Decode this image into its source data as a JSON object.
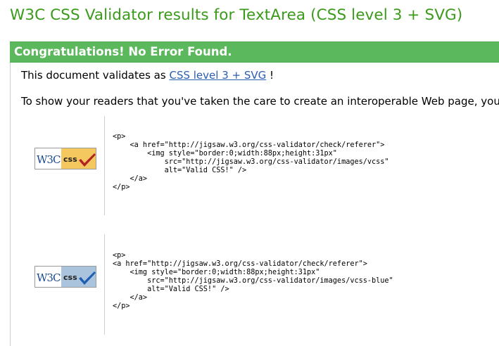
{
  "title": "W3C CSS Validator results for TextArea (CSS level 3 + SVG)",
  "banner": "Congratulations! No Error Found.",
  "validates": {
    "prefix": "This document validates as ",
    "link": "CSS level 3 + SVG",
    "suffix": " !"
  },
  "show_text": "To show your readers that you've taken the care to create an interoperable Web page, you may display this icon on any page that validates. Here is the XHTML you could use to add this icon to your Web page:",
  "badges": [
    {
      "variant": "vcss",
      "badge_label": "W3C css",
      "colors": {
        "css_bg": "#f5c75f",
        "check": "#b22222"
      },
      "code": "<p>\n    <a href=\"http://jigsaw.w3.org/css-validator/check/referer\">\n        <img style=\"border:0;width:88px;height:31px\"\n            src=\"http://jigsaw.w3.org/css-validator/images/vcss\"\n            alt=\"Valid CSS!\" />\n    </a>\n</p>"
    },
    {
      "variant": "vcss-blue",
      "badge_label": "W3C css",
      "colors": {
        "css_bg": "#a9c4dc",
        "check": "#1e5fb4"
      },
      "code": "<p>\n<a href=\"http://jigsaw.w3.org/css-validator/check/referer\">\n    <img style=\"border:0;width:88px;height:31px\"\n        src=\"http://jigsaw.w3.org/css-validator/images/vcss-blue\"\n        alt=\"Valid CSS!\" />\n    </a>\n</p>"
    }
  ]
}
